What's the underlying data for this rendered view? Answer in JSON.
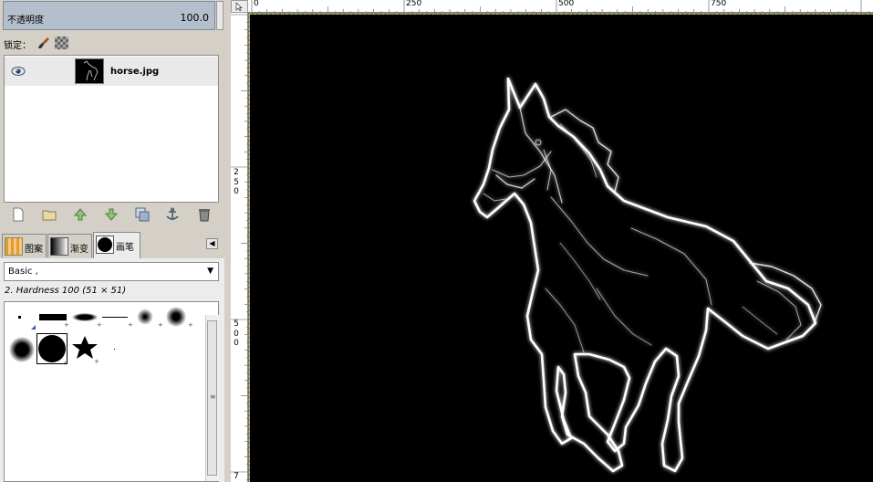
{
  "layers_panel": {
    "opacity_label": "不透明度",
    "opacity_value": "100.0",
    "lock_label": "锁定：",
    "layer": {
      "name": "horse.jpg"
    },
    "buttons": [
      "new-layer-icon",
      "new-group-icon",
      "raise-icon",
      "lower-icon",
      "duplicate-icon",
      "anchor-icon",
      "delete-icon"
    ]
  },
  "dock_tabs": [
    {
      "label": "图案",
      "active": false
    },
    {
      "label": "渐变",
      "active": false
    },
    {
      "label": "画笔",
      "active": true
    }
  ],
  "tab_menu_glyph": "◀",
  "brushes_panel": {
    "filter_value": "Basic ,",
    "dropdown_glyph": "▼",
    "selected_brush": "2. Hardness 100 (51 × 51)",
    "scroll_grip": "≡"
  },
  "ruler": {
    "h_labels": [
      "0",
      "250",
      "500",
      "750"
    ],
    "v_labels": [
      [
        "2",
        "5",
        "0"
      ],
      [
        "5",
        "0",
        "0"
      ],
      [
        "7"
      ]
    ]
  },
  "colors": {
    "opacity_bg": "#b3bfcc",
    "canvas_bg": "#000000",
    "selection_dash": "#d8c030",
    "glow": "#ffffff"
  }
}
